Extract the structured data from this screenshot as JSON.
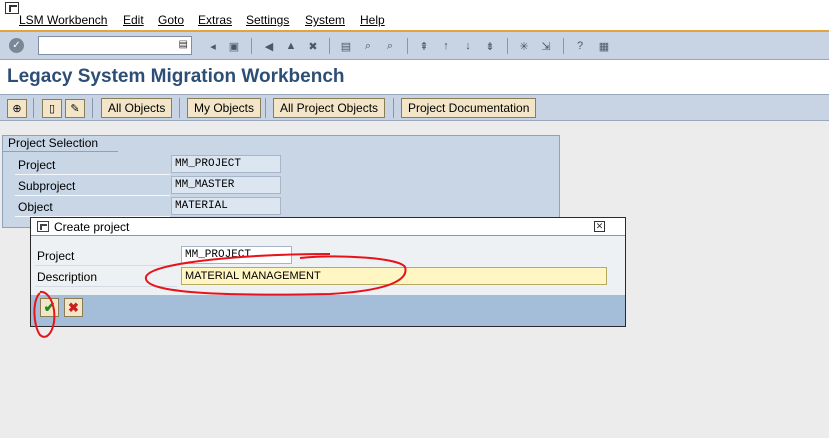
{
  "menu": {
    "items": [
      {
        "label": "LSM Workbench"
      },
      {
        "label": "Edit"
      },
      {
        "label": "Goto"
      },
      {
        "label": "Extras"
      },
      {
        "label": "Settings"
      },
      {
        "label": "System"
      },
      {
        "label": "Help"
      }
    ]
  },
  "command_field": {
    "value": "",
    "placeholder": ""
  },
  "page": {
    "title": "Legacy System Migration Workbench"
  },
  "app_toolbar": {
    "all_objects": "All Objects",
    "my_objects": "My Objects",
    "all_project_objects": "All Project Objects",
    "project_documentation": "Project Documentation"
  },
  "selection": {
    "title": "Project Selection",
    "fields": [
      {
        "label": "Project",
        "value": "MM_PROJECT"
      },
      {
        "label": "Subproject",
        "value": "MM_MASTER"
      },
      {
        "label": "Object",
        "value": "MATERIAL"
      }
    ]
  },
  "dialog": {
    "title": "Create project",
    "project_label": "Project",
    "project_value": "MM_PROJECT",
    "description_label": "Description",
    "description_value": "MATERIAL MANAGEMENT"
  },
  "colors": {
    "annotation": "#e8131a",
    "title": "#2d4f76",
    "toolbar": "#c8d3e3",
    "accent": "#e6a23c"
  }
}
